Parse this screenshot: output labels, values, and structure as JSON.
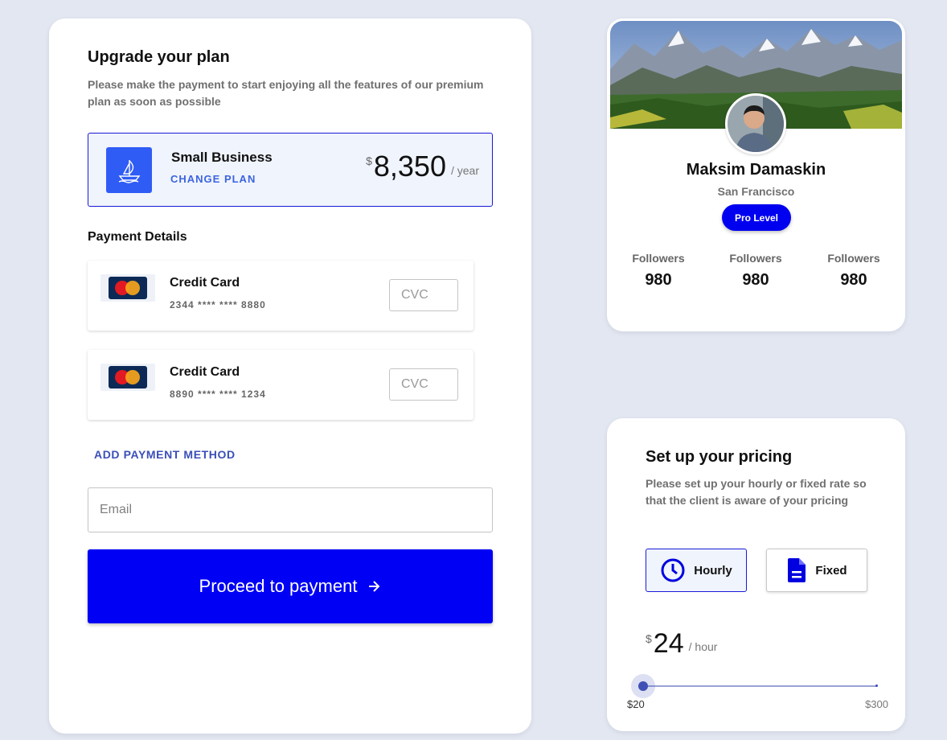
{
  "upgrade": {
    "title": "Upgrade your plan",
    "subtitle": "Please make the payment to start enjoying all the features of our premium plan as soon as possible",
    "plan": {
      "icon": "sailboat-icon",
      "name": "Small Business",
      "change_label": "CHANGE PLAN",
      "currency": "$",
      "price": "8,350",
      "period": "/ year"
    },
    "payment_details_label": "Payment Details",
    "cards": [
      {
        "icon": "mastercard-logo",
        "logo_text": "MasterCard",
        "title": "Credit Card",
        "number": "2344 **** **** 8880",
        "cvc_placeholder": "CVC"
      },
      {
        "icon": "mastercard-logo",
        "logo_text": "MasterCard",
        "title": "Credit Card",
        "number": "8890 **** **** 1234",
        "cvc_placeholder": "CVC"
      }
    ],
    "add_payment_label": "ADD PAYMENT METHOD",
    "email_placeholder": "Email",
    "proceed_label": "Proceed to payment",
    "proceed_icon": "arrow-right-icon"
  },
  "profile": {
    "name": "Maksim Damaskin",
    "location": "San Francisco",
    "badge": "Pro Level",
    "stats": [
      {
        "label": "Followers",
        "value": "980"
      },
      {
        "label": "Followers",
        "value": "980"
      },
      {
        "label": "Followers",
        "value": "980"
      }
    ]
  },
  "pricing": {
    "title": "Set up your pricing",
    "subtitle": "Please set up your hourly or fixed rate so that the client is aware of your pricing",
    "options": [
      {
        "label": "Hourly",
        "icon": "clock-icon",
        "selected": true
      },
      {
        "label": "Fixed",
        "icon": "document-icon",
        "selected": false
      }
    ],
    "currency": "$",
    "rate": "24",
    "period": "/ hour",
    "slider": {
      "min_label": "$20",
      "max_label": "$300",
      "min": 20,
      "max": 300,
      "value": 24
    }
  },
  "colors": {
    "page_bg": "#e3e7f1",
    "primary": "#0000f5",
    "plan_icon_bg": "#2f5cf5",
    "link": "#3b64e0",
    "slider": "#3f51b5"
  }
}
